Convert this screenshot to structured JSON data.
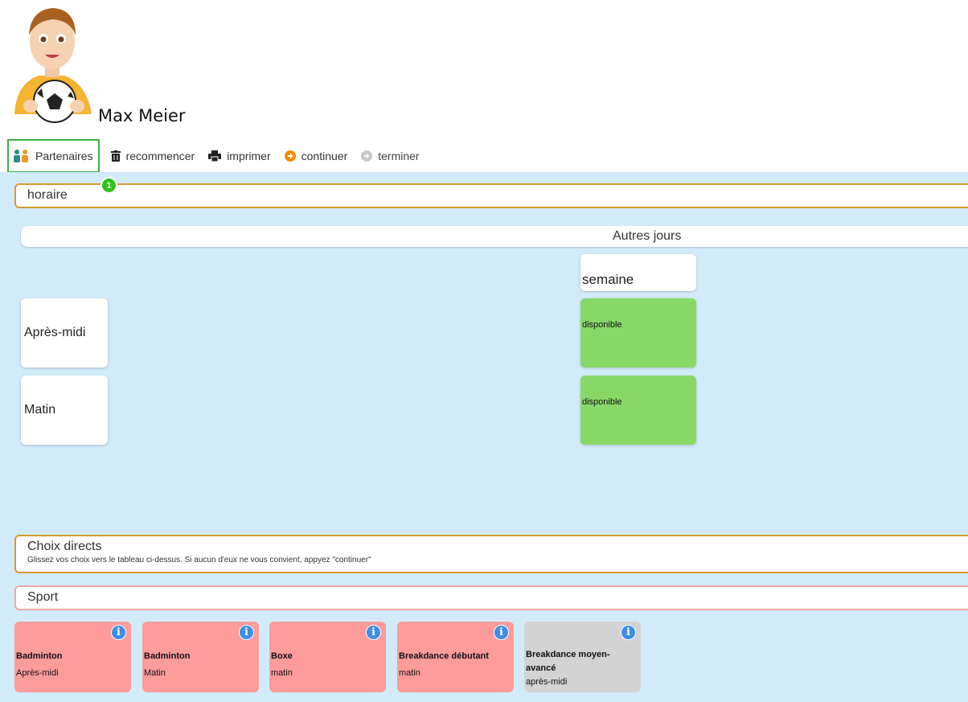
{
  "user": {
    "name": "Max Meier"
  },
  "toolbar": {
    "partners": "Partenaires",
    "restart": "recommencer",
    "print": "imprimer",
    "continue": "continuer",
    "finish": "terminer",
    "badge_count": "1"
  },
  "schedule": {
    "title": "horaire",
    "group_header": "Autres jours",
    "column": "semaine",
    "rows": [
      {
        "label": "Après-midi",
        "slot": "disponible"
      },
      {
        "label": "Matin",
        "slot": "disponible"
      }
    ]
  },
  "direct_choices": {
    "title": "Choix directs",
    "description": "Glissez vos choix vers le tableau ci-dessus. Si aucun d'eux ne vous convient, appyez \"continuer\""
  },
  "sport": {
    "title": "Sport",
    "activities": [
      {
        "name": "Badminton",
        "time": "Après-midi",
        "status": "available"
      },
      {
        "name": "Badminton",
        "time": "Matin",
        "status": "available"
      },
      {
        "name": "Boxe",
        "time": "matin",
        "status": "available"
      },
      {
        "name": "Breakdance débutant",
        "time": "matin",
        "status": "available"
      },
      {
        "name": "Breakdance moyen-avancé",
        "time": "après-midi",
        "status": "unavailable"
      }
    ]
  },
  "colors": {
    "available_slot": "#88d867",
    "activity_pink": "#fe9b9b",
    "activity_grey": "#d3d3d3",
    "panel_border": "#d59a2e",
    "sport_border": "#f0a6a6",
    "background": "#d2ebfa",
    "info_icon": "#3c8ee6"
  }
}
